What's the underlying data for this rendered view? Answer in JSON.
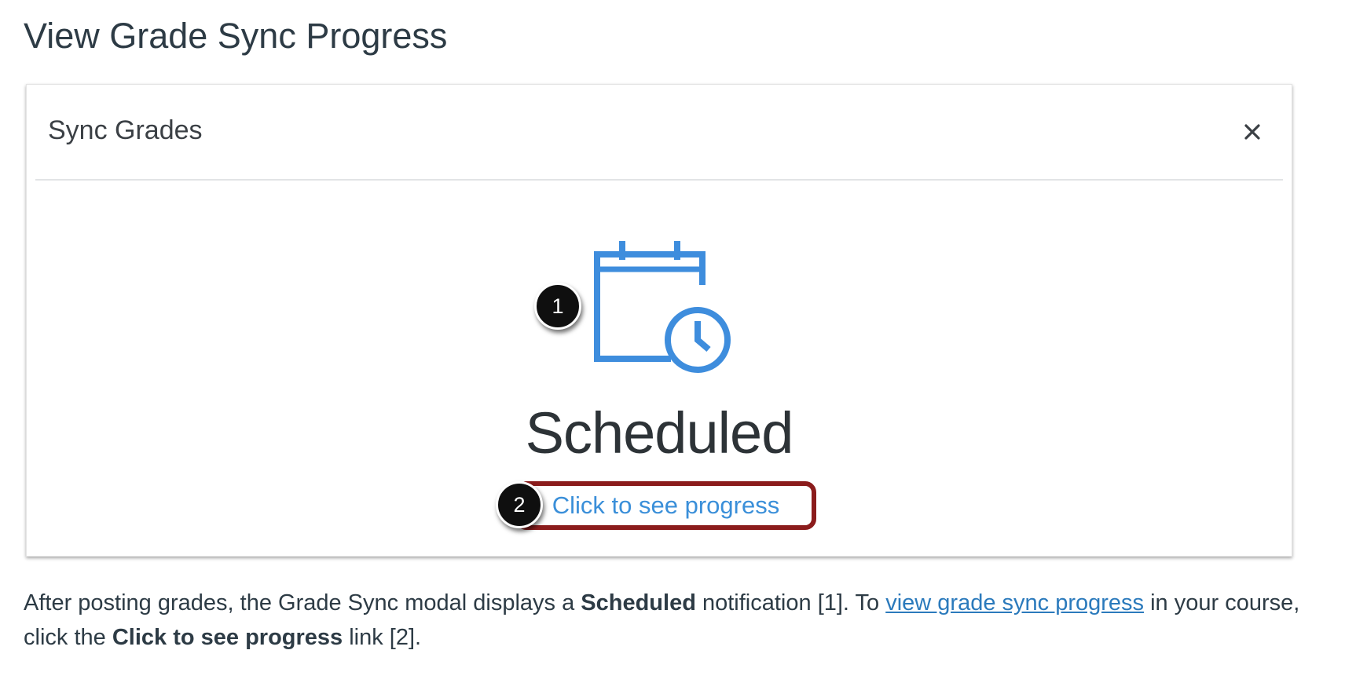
{
  "page": {
    "title": "View Grade Sync Progress"
  },
  "modal": {
    "title": "Sync Grades",
    "close_symbol": "×",
    "status": "Scheduled",
    "progress_link": "Click to see progress",
    "icon": "calendar-clock-icon",
    "icon_color": "#3e8ddd",
    "highlight_color": "#8b1c1c"
  },
  "callouts": {
    "one": "1",
    "two": "2"
  },
  "description": {
    "part1": "After posting grades, the Grade Sync modal displays a ",
    "bold1": "Scheduled",
    "part2": " notification [1]. To ",
    "link": "view grade sync progress",
    "part3": " in your course, click the ",
    "bold2": "Click to see progress",
    "part4": " link [2]."
  }
}
